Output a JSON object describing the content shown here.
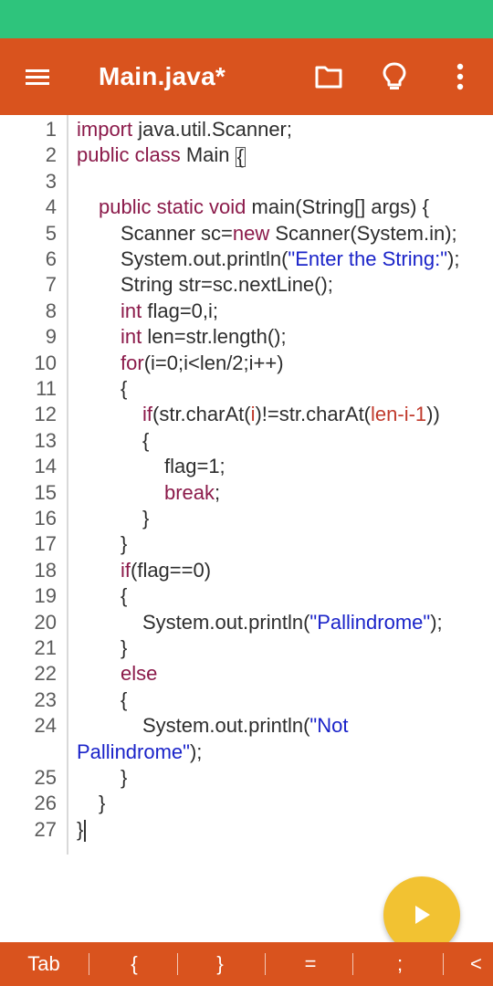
{
  "app_bar": {
    "title": "Main.java*",
    "icons": [
      "hamburger-menu-icon",
      "folder-icon",
      "lightbulb-icon",
      "more-vert-icon"
    ]
  },
  "editor": {
    "lines": [
      {
        "n": "1",
        "indent": 0,
        "tokens": [
          {
            "t": "import",
            "c": "kw"
          },
          {
            "t": " java.util.Scanner;",
            "c": ""
          }
        ]
      },
      {
        "n": "2",
        "indent": 0,
        "tokens": [
          {
            "t": "public class",
            "c": "kw"
          },
          {
            "t": " Main ",
            "c": ""
          }
        ],
        "bracket": "{"
      },
      {
        "n": "3",
        "indent": 0,
        "tokens": []
      },
      {
        "n": "4",
        "indent": 1,
        "tokens": [
          {
            "t": "public static void",
            "c": "kw"
          },
          {
            "t": " main(String[] args) {",
            "c": ""
          }
        ]
      },
      {
        "n": "5",
        "indent": 2,
        "tokens": [
          {
            "t": "Scanner sc=",
            "c": ""
          },
          {
            "t": "new",
            "c": "kw"
          },
          {
            "t": " Scanner(System.in);",
            "c": ""
          }
        ]
      },
      {
        "n": "6",
        "indent": 2,
        "tokens": [
          {
            "t": "System.out.println(",
            "c": ""
          },
          {
            "t": "\"Enter the String:\"",
            "c": "st"
          },
          {
            "t": ");",
            "c": ""
          }
        ]
      },
      {
        "n": "7",
        "indent": 2,
        "tokens": [
          {
            "t": "String str=sc.nextLine();",
            "c": ""
          }
        ]
      },
      {
        "n": "8",
        "indent": 2,
        "tokens": [
          {
            "t": "int",
            "c": "kw"
          },
          {
            "t": " flag=0,i;",
            "c": ""
          }
        ]
      },
      {
        "n": "9",
        "indent": 2,
        "tokens": [
          {
            "t": "int",
            "c": "kw"
          },
          {
            "t": " len=str.length();",
            "c": ""
          }
        ]
      },
      {
        "n": "10",
        "indent": 2,
        "tokens": [
          {
            "t": "for",
            "c": "kw"
          },
          {
            "t": "(i=0;i<len/2;i++)",
            "c": ""
          }
        ]
      },
      {
        "n": "11",
        "indent": 2,
        "tokens": [
          {
            "t": "{",
            "c": ""
          }
        ]
      },
      {
        "n": "12",
        "indent": 3,
        "tokens": [
          {
            "t": "if",
            "c": "kw"
          },
          {
            "t": "(str.charAt(",
            "c": ""
          },
          {
            "t": "i",
            "c": "nm"
          },
          {
            "t": ")!=str.charAt(",
            "c": ""
          },
          {
            "t": "len-i-1",
            "c": "nm"
          },
          {
            "t": "))",
            "c": ""
          }
        ]
      },
      {
        "n": "13",
        "indent": 3,
        "tokens": [
          {
            "t": "{",
            "c": ""
          }
        ]
      },
      {
        "n": "14",
        "indent": 4,
        "tokens": [
          {
            "t": "flag=1;",
            "c": ""
          }
        ]
      },
      {
        "n": "15",
        "indent": 4,
        "tokens": [
          {
            "t": "break",
            "c": "kw"
          },
          {
            "t": ";",
            "c": ""
          }
        ]
      },
      {
        "n": "16",
        "indent": 3,
        "tokens": [
          {
            "t": "}",
            "c": ""
          }
        ]
      },
      {
        "n": "17",
        "indent": 2,
        "tokens": [
          {
            "t": "}",
            "c": ""
          }
        ]
      },
      {
        "n": "18",
        "indent": 2,
        "tokens": [
          {
            "t": "if",
            "c": "kw"
          },
          {
            "t": "(flag==0)",
            "c": ""
          }
        ]
      },
      {
        "n": "19",
        "indent": 2,
        "tokens": [
          {
            "t": "{",
            "c": ""
          }
        ]
      },
      {
        "n": "20",
        "indent": 3,
        "tokens": [
          {
            "t": "System.out.println(",
            "c": ""
          },
          {
            "t": "\"Pallindrome\"",
            "c": "st"
          },
          {
            "t": ");",
            "c": ""
          }
        ]
      },
      {
        "n": "21",
        "indent": 2,
        "tokens": [
          {
            "t": "}",
            "c": ""
          }
        ]
      },
      {
        "n": "22",
        "indent": 2,
        "tokens": [
          {
            "t": "else",
            "c": "kw"
          }
        ]
      },
      {
        "n": "23",
        "indent": 2,
        "tokens": [
          {
            "t": "{",
            "c": ""
          }
        ]
      },
      {
        "n": "24",
        "indent": 3,
        "tokens": [
          {
            "t": "System.out.println(",
            "c": ""
          },
          {
            "t": "\"Not",
            "c": "st"
          }
        ]
      },
      {
        "n": "",
        "indent": 0,
        "tokens": [
          {
            "t": "Pallindrome\"",
            "c": "st"
          },
          {
            "t": ");",
            "c": ""
          }
        ]
      },
      {
        "n": "25",
        "indent": 2,
        "tokens": [
          {
            "t": "}",
            "c": ""
          }
        ]
      },
      {
        "n": "26",
        "indent": 1,
        "tokens": [
          {
            "t": "}",
            "c": ""
          }
        ]
      },
      {
        "n": "27",
        "indent": 0,
        "tokens": [
          {
            "t": "}",
            "c": ""
          }
        ],
        "caret": true
      }
    ]
  },
  "fab": {
    "icon": "play-icon"
  },
  "bottom_bar": {
    "keys": [
      "Tab",
      "{",
      "}",
      "=",
      ";",
      "<"
    ]
  }
}
